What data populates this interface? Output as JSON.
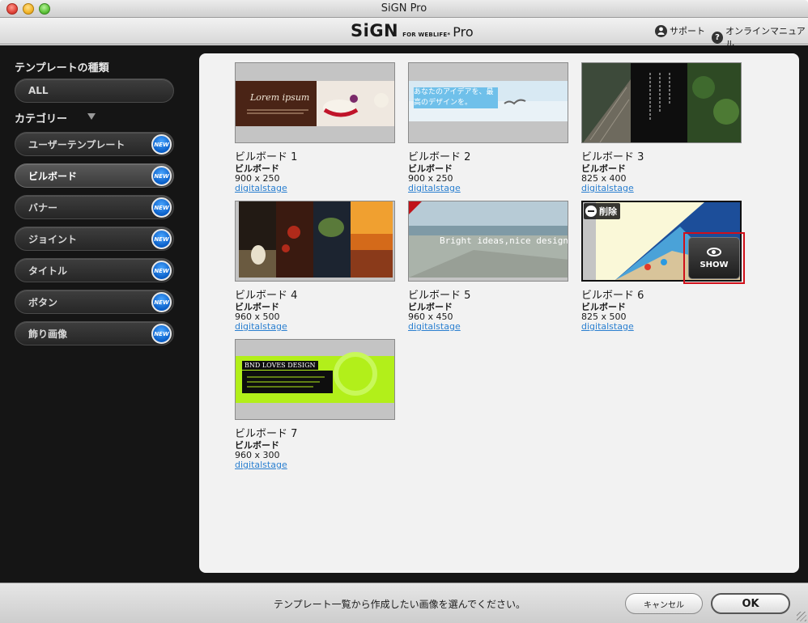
{
  "window": {
    "title": "SiGN Pro"
  },
  "header": {
    "logo": {
      "main": "SiGN",
      "sub": "FOR WEBLIFE*",
      "pro": "Pro"
    },
    "support_label": "サポート",
    "manual_label": "オンラインマニュアル"
  },
  "sidebar": {
    "heading": "テンプレートの種類",
    "all_label": "ALL",
    "category_heading": "カテゴリー",
    "new_badge": "NEW",
    "categories": [
      {
        "label": "ユーザーテンプレート"
      },
      {
        "label": "ビルボード",
        "selected": true
      },
      {
        "label": "バナー"
      },
      {
        "label": "ジョイント"
      },
      {
        "label": "タイトル"
      },
      {
        "label": "ボタン"
      },
      {
        "label": "飾り画像"
      }
    ]
  },
  "templates": [
    {
      "title": "ビルボード 1",
      "category": "ビルボード",
      "size": "900 x 250",
      "author": "digitalstage",
      "thumb_text": "Lorem ipsum"
    },
    {
      "title": "ビルボード 2",
      "category": "ビルボード",
      "size": "900 x 250",
      "author": "digitalstage",
      "thumb_text": "あなたのアイデアを、最高のデザインを。"
    },
    {
      "title": "ビルボード 3",
      "category": "ビルボード",
      "size": "825 x 400",
      "author": "digitalstage"
    },
    {
      "title": "ビルボード 4",
      "category": "ビルボード",
      "size": "960 x 500",
      "author": "digitalstage"
    },
    {
      "title": "ビルボード 5",
      "category": "ビルボード",
      "size": "960 x 450",
      "author": "digitalstage",
      "thumb_text": "Bright ideas,nice design."
    },
    {
      "title": "ビルボード 6",
      "category": "ビルボード",
      "size": "825 x 500",
      "author": "digitalstage",
      "delete_label": "削除",
      "show_label": "SHOW"
    },
    {
      "title": "ビルボード 7",
      "category": "ビルボード",
      "size": "960 x 300",
      "author": "digitalstage",
      "thumb_text": "BND LOVES DESIGN"
    }
  ],
  "footer": {
    "message": "テンプレート一覧から作成したい画像を選んでください。",
    "cancel_label": "キャンセル",
    "ok_label": "OK"
  },
  "colors": {
    "accent_link": "#2a7fd0",
    "badge_blue": "#0a5fc8",
    "highlight_red": "#d0101a",
    "sidebar_bg": "#151515"
  }
}
